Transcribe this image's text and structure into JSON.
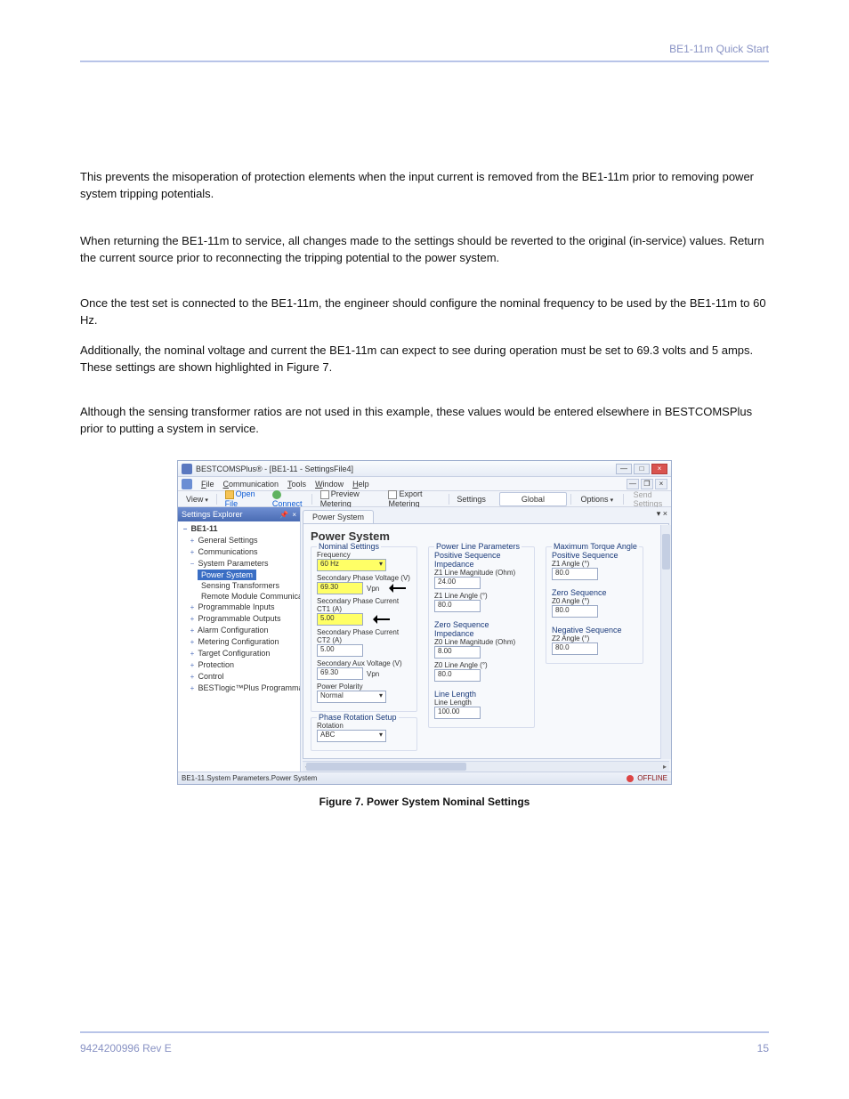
{
  "page_header": {
    "right": "BE1-11m Quick Start",
    "left": ""
  },
  "page_footer": {
    "left": "9424200996 Rev E",
    "right": "15"
  },
  "paragraphs": {
    "p1": "This prevents the misoperation of protection elements when the input current is removed from the BE1-11m prior to removing power system tripping potentials.",
    "p2": "When returning the BE1-11m to service, all changes made to the settings should be reverted to the original (in-service) values. Return the current source prior to reconnecting the tripping potential to the power system.",
    "p3": "Once the test set is connected to the BE1-11m, the engineer should configure the nominal frequency to be used by the BE1-11m to 60 Hz.",
    "p4": "Additionally, the nominal voltage and current the BE1-11m can expect to see during operation must be set to 69.3 volts and 5 amps. These settings are shown highlighted in Figure 7.",
    "p5": "Although the sensing transformer ratios are not used in this example, these values would be entered elsewhere in BESTCOMSPlus prior to putting a system in service."
  },
  "app": {
    "title": "BESTCOMSPlus® - [BE1-11 - SettingsFile4]",
    "menu": [
      "File",
      "Communication",
      "Tools",
      "Window",
      "Help"
    ],
    "toolbar": {
      "view": "View",
      "open": "Open File",
      "connect": "Connect",
      "preview": "Preview Metering",
      "export": "Export Metering",
      "settings": "Settings",
      "global": "Global",
      "options": "Options",
      "send": "Send Settings"
    },
    "settings_explorer": "Settings Explorer",
    "pins": {
      "pin": "📌",
      "close": "×",
      "drop": "▾"
    },
    "tree": {
      "root": "BE1-11",
      "nodes": [
        {
          "label": "General Settings",
          "exp": "+"
        },
        {
          "label": "Communications",
          "exp": "+"
        },
        {
          "label": "System Parameters",
          "exp": "−",
          "children": [
            {
              "label": "Power System",
              "sel": true
            },
            {
              "label": "Sensing Transformers"
            },
            {
              "label": "Remote Module Communications"
            }
          ]
        },
        {
          "label": "Programmable Inputs",
          "exp": "+"
        },
        {
          "label": "Programmable Outputs",
          "exp": "+"
        },
        {
          "label": "Alarm Configuration",
          "exp": "+"
        },
        {
          "label": "Metering Configuration",
          "exp": "+"
        },
        {
          "label": "Target Configuration",
          "exp": "+"
        },
        {
          "label": "Protection",
          "exp": "+"
        },
        {
          "label": "Control",
          "exp": "+"
        },
        {
          "label": "BESTlogic™Plus Programmable Logic",
          "exp": "+"
        }
      ]
    },
    "tab": "Power System",
    "heading": "Power System",
    "nominal": {
      "legend": "Nominal Settings",
      "freq_lbl": "Frequency",
      "freq": "60 Hz",
      "spv_lbl": "Secondary Phase Voltage (V)",
      "spv": "69.30",
      "spv_unit": "Vpn",
      "spc1_lbl": "Secondary Phase Current CT1 (A)",
      "spc1": "5.00",
      "spc2_lbl": "Secondary Phase Current CT2 (A)",
      "spc2": "5.00",
      "sav_lbl": "Secondary Aux Voltage (V)",
      "sav": "69.30",
      "sav_unit": "Vpn",
      "pol_lbl": "Power Polarity",
      "pol": "Normal"
    },
    "rotation": {
      "legend": "Phase Rotation Setup",
      "lbl": "Rotation",
      "val": "ABC"
    },
    "pline": {
      "legend": "Power Line Parameters",
      "psi": "Positive Sequence Impedance",
      "z1m_lbl": "Z1 Line Magnitude (Ohm)",
      "z1m": "24.00",
      "z1a_lbl": "Z1 Line Angle (°)",
      "z1a": "80.0",
      "zsi": "Zero Sequence Impedance",
      "z0m_lbl": "Z0 Line Magnitude (Ohm)",
      "z0m": "8.00",
      "z0a_lbl": "Z0 Line Angle (°)",
      "z0a": "80.0",
      "ll_legend": "Line Length",
      "ll_lbl": "Line Length",
      "ll": "100.00"
    },
    "torque": {
      "legend": "Maximum Torque Angle",
      "ps": "Positive Sequence",
      "z1a_lbl": "Z1 Angle (°)",
      "z1a": "80.0",
      "zs": "Zero Sequence",
      "z0a_lbl": "Z0 Angle (°)",
      "z0a": "80.0",
      "ns": "Negative Sequence",
      "z2a_lbl": "Z2 Angle (°)",
      "z2a": "80.0"
    },
    "status": {
      "path": "BE1-11.System Parameters.Power System",
      "offline": "OFFLINE"
    }
  },
  "figure_caption": "Figure 7. Power System Nominal Settings"
}
